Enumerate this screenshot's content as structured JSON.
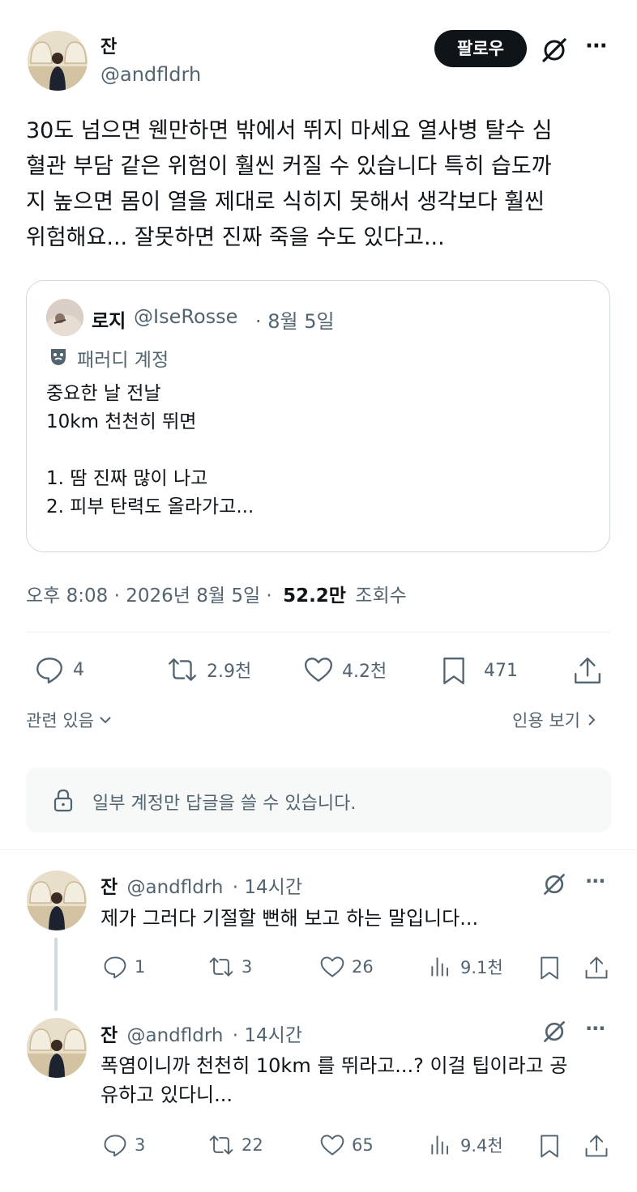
{
  "main_tweet": {
    "author_name": "잔",
    "author_handle": "@andfldrh",
    "follow_label": "팔로우",
    "more_label": "···",
    "text_lines": [
      "30도 넘으면 웬만하면 밖에서 뛰지 마세요 열사병 탈수 심",
      "혈관 부담 같은 위험이 훨씬 커질 수 있습니다 특히 습도까",
      "지 높으면 몸이 열을 제대로 식히지 못해서 생각보다 훨씬",
      "위험해요... 잘못하면 진짜 죽을 수도 있다고..."
    ],
    "quote": {
      "author_name": "로지",
      "author_handle": "@IseRosse",
      "date": "· 8월 5일",
      "account_label": "패러디 계정",
      "text_lines": [
        "중요한 날 전날",
        "10km 천천히 뛰면",
        "",
        "1. 땀 진짜 많이 나고",
        "2. 피부 탄력도 올라가고..."
      ]
    },
    "meta_time": "오후 8:08 · 2026년 8월 5일 ·",
    "meta_views_count": "52.2만",
    "meta_views_label": "조회수",
    "stats": {
      "replies": "4",
      "retweets": "2.9천",
      "likes": "4.2천",
      "bookmarks": "471"
    },
    "related_label": "관련 있음",
    "quotes_label": "인용 보기",
    "reply_restriction": "일부 계정만 답글을 쓸 수 있습니다."
  },
  "replies": [
    {
      "author_name": "잔",
      "author_handle": "@andfldrh",
      "time": "· 14시간",
      "text_lines": [
        "제가 그러다 기절할 뻔해 보고 하는 말입니다..."
      ],
      "replies": "1",
      "retweets": "3",
      "likes": "26",
      "views": "9.1천"
    },
    {
      "author_name": "잔",
      "author_handle": "@andfldrh",
      "time": "· 14시간",
      "text_lines": [
        "폭염이니까 천천히 10km 를 뛰라고...? 이걸 팁이라고 공",
        "유하고 있다니..."
      ],
      "replies": "3",
      "retweets": "22",
      "likes": "65",
      "views": "9.4천"
    }
  ],
  "colors": {
    "text": "#0f1419",
    "muted": "#536471",
    "border": "#cfd9de",
    "divider": "#eff3f4",
    "notice_bg": "#f7f9f9"
  }
}
